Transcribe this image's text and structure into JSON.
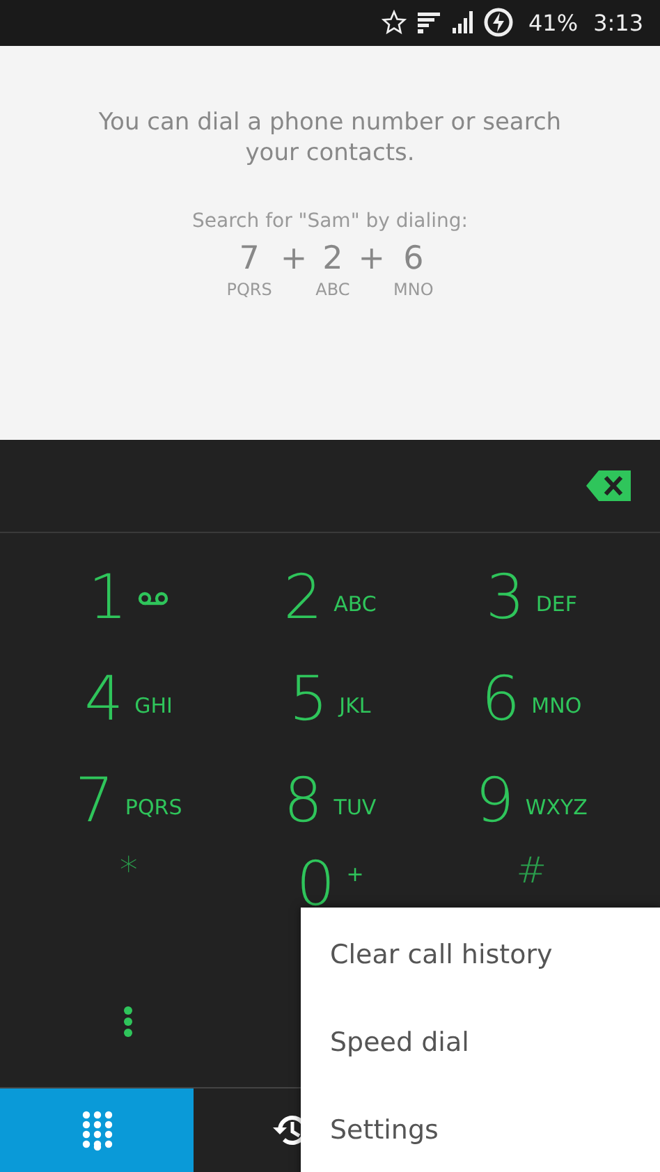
{
  "status_bar": {
    "battery": "41%",
    "time": "3:13"
  },
  "hint": {
    "message": "You can dial a phone number or search your contacts.",
    "example_title": "Search for \"Sam\" by dialing:",
    "separator": "+",
    "example": [
      {
        "digit": "7",
        "letters": "PQRS"
      },
      {
        "digit": "2",
        "letters": "ABC"
      },
      {
        "digit": "6",
        "letters": "MNO"
      }
    ]
  },
  "keypad": [
    {
      "kind": "voicemail",
      "digit": "1"
    },
    {
      "kind": "letters",
      "digit": "2",
      "letters": "ABC"
    },
    {
      "kind": "letters",
      "digit": "3",
      "letters": "DEF"
    },
    {
      "kind": "letters",
      "digit": "4",
      "letters": "GHI"
    },
    {
      "kind": "letters",
      "digit": "5",
      "letters": "JKL"
    },
    {
      "kind": "letters",
      "digit": "6",
      "letters": "MNO"
    },
    {
      "kind": "letters",
      "digit": "7",
      "letters": "PQRS"
    },
    {
      "kind": "letters",
      "digit": "8",
      "letters": "TUV"
    },
    {
      "kind": "letters",
      "digit": "9",
      "letters": "WXYZ"
    },
    {
      "kind": "symbol",
      "digit": "*"
    },
    {
      "kind": "letters",
      "digit": "0",
      "letters": "+"
    },
    {
      "kind": "symbol",
      "digit": "#"
    }
  ],
  "tabs": [
    {
      "kind": "dialpad",
      "selected": true
    },
    {
      "kind": "history",
      "selected": false
    }
  ],
  "menu": [
    "Clear call history",
    "Speed dial",
    "Settings"
  ]
}
